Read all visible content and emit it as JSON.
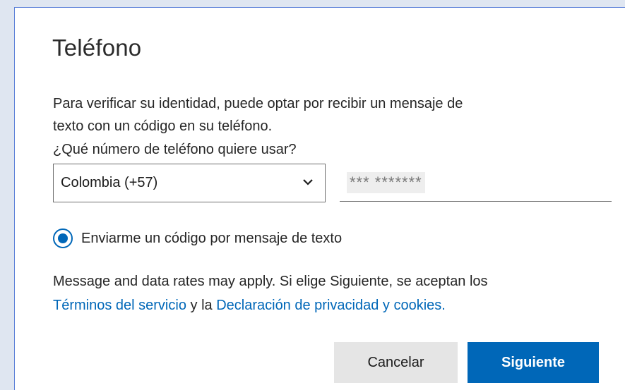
{
  "dialog": {
    "title": "Teléfono",
    "description_line1": "Para verificar su identidad, puede optar por recibir un mensaje de",
    "description_line2": "texto con un código en su teléfono.",
    "question": "¿Qué número de teléfono quiere usar?",
    "country_select": {
      "selected": "Colombia (+57)"
    },
    "phone_input": {
      "value": "*** *******"
    },
    "radio_option": {
      "label": "Enviarme un código por mensaje de texto",
      "checked": true
    },
    "rates_text_before": "Message and data rates may apply. Si elige Siguiente, se aceptan los",
    "terms_link": "Términos del servicio",
    "and_text": "y la",
    "privacy_link": "Declaración de privacidad y cookies.",
    "cancel_button": "Cancelar",
    "next_button": "Siguiente"
  },
  "colors": {
    "accent": "#0067b8",
    "cancel_bg": "#e5e5e5",
    "text": "#262626"
  },
  "icons": {
    "select_chevron": "chevron-down-icon",
    "radio": "radio-selected-icon"
  }
}
